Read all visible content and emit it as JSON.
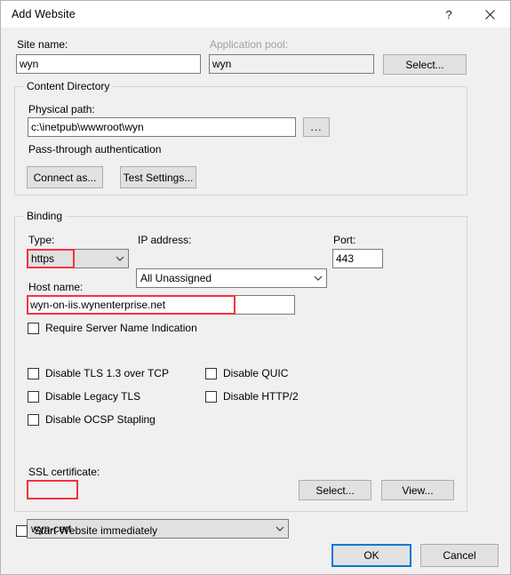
{
  "window": {
    "title": "Add Website",
    "help_icon": "question-mark-icon",
    "close_icon": "close-icon"
  },
  "site": {
    "site_name_label": "Site name:",
    "site_name_value": "wyn",
    "app_pool_label": "Application pool:",
    "app_pool_value": "wyn",
    "app_pool_select_button": "Select..."
  },
  "content_directory": {
    "group_title": "Content Directory",
    "physical_path_label": "Physical path:",
    "physical_path_value": "c:\\inetpub\\wwwroot\\wyn",
    "browse_button": "...",
    "pass_through_label": "Pass-through authentication",
    "connect_as_button": "Connect as...",
    "test_settings_button": "Test Settings..."
  },
  "binding": {
    "group_title": "Binding",
    "type_label": "Type:",
    "type_value": "https",
    "ip_label": "IP address:",
    "ip_value": "All Unassigned",
    "port_label": "Port:",
    "port_value": "443",
    "host_label": "Host name:",
    "host_value": "wyn-on-iis.wynenterprise.net",
    "require_sni_label": "Require Server Name Indication",
    "require_sni_checked": false,
    "options": [
      {
        "label": "Disable TLS 1.3 over TCP",
        "checked": false
      },
      {
        "label": "Disable QUIC",
        "checked": false
      },
      {
        "label": "Disable Legacy TLS",
        "checked": false
      },
      {
        "label": "Disable HTTP/2",
        "checked": false
      },
      {
        "label": "Disable OCSP Stapling",
        "checked": false
      }
    ],
    "ssl_label": "SSL certificate:",
    "ssl_value": "wyn-cert",
    "ssl_select_button": "Select...",
    "ssl_view_button": "View..."
  },
  "footer": {
    "start_website_label": "Start Website immediately",
    "start_website_checked": false,
    "ok_button": "OK",
    "cancel_button": "Cancel"
  },
  "annotations": {
    "accent_red": "#f5333f",
    "focus_blue": "#0078d7"
  }
}
